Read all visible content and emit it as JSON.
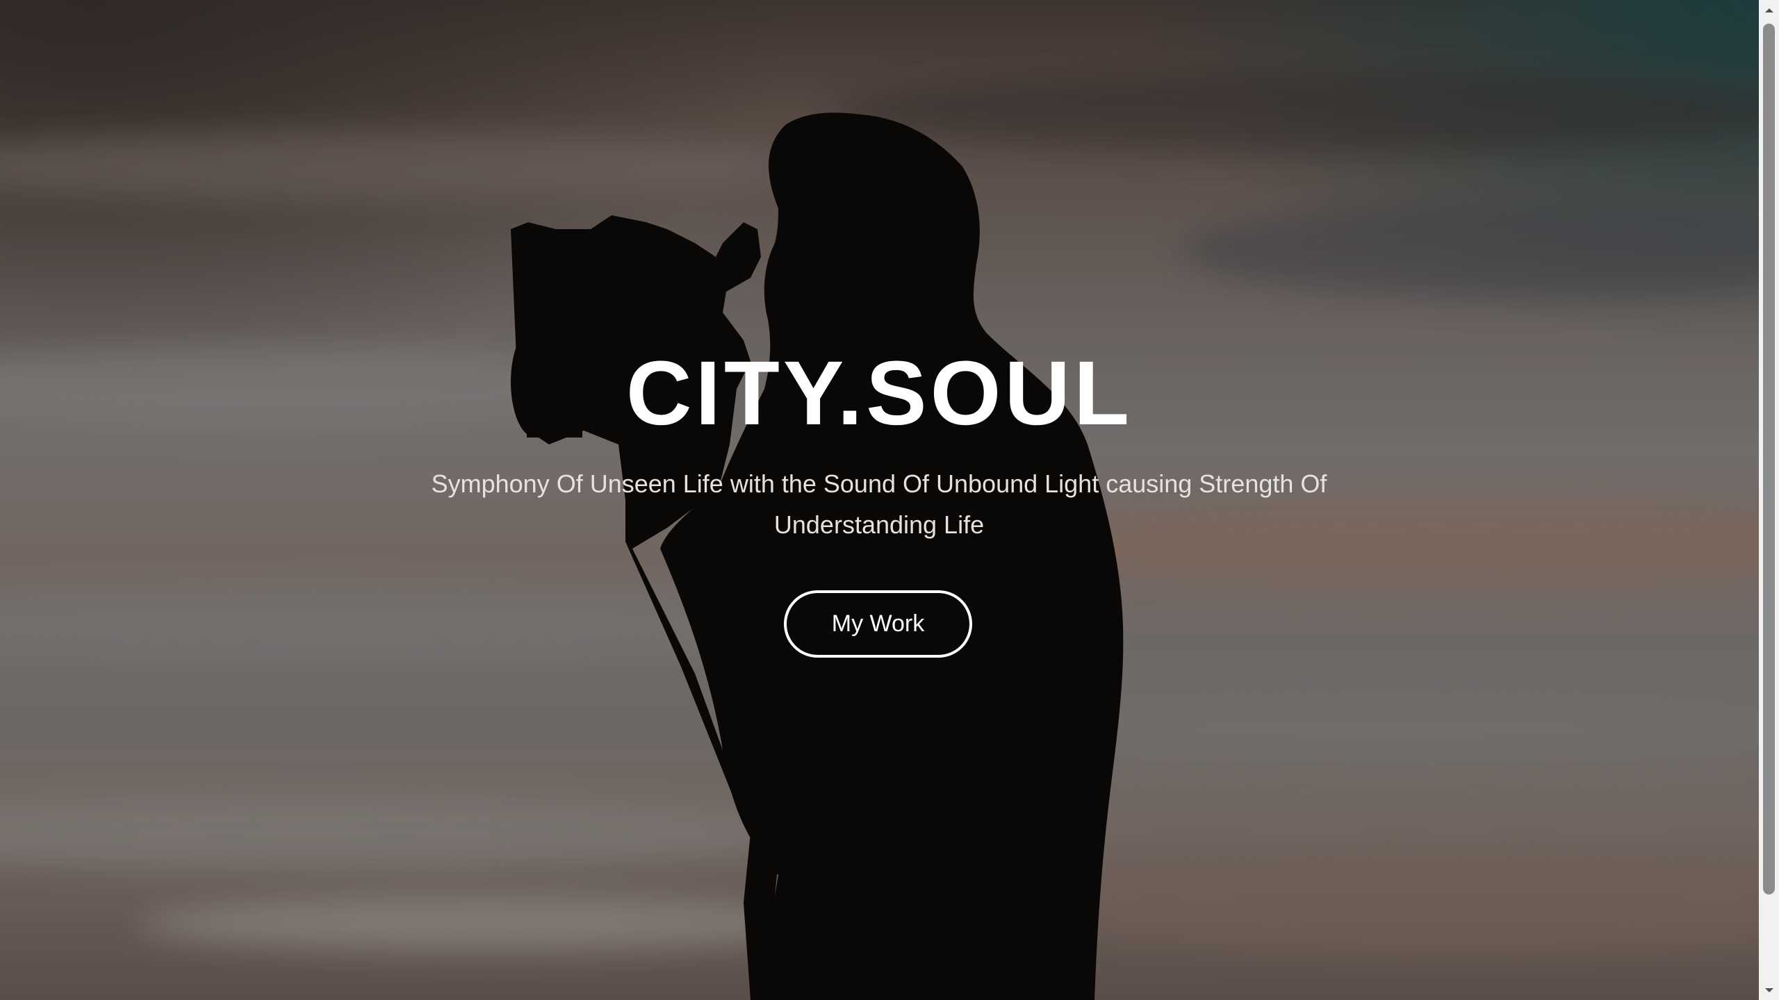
{
  "hero": {
    "title": "CITY.SOUL",
    "subtitle": "Symphony Of Unseen Life with the Sound Of Unbound Light causing Strength Of Understanding Life",
    "cta_label": "My Work",
    "background_image": "photographer-silhouette-sunset-sky"
  },
  "scrollbar": {
    "up_icon": "chevron-up-icon",
    "down_icon": "chevron-down-icon"
  },
  "colors": {
    "title": "#ffffff",
    "subtitle": "#e6e2df",
    "button_border": "#ffffff",
    "scrollbar_track": "#f1f1f1",
    "scrollbar_thumb": "#8b8b8b"
  }
}
